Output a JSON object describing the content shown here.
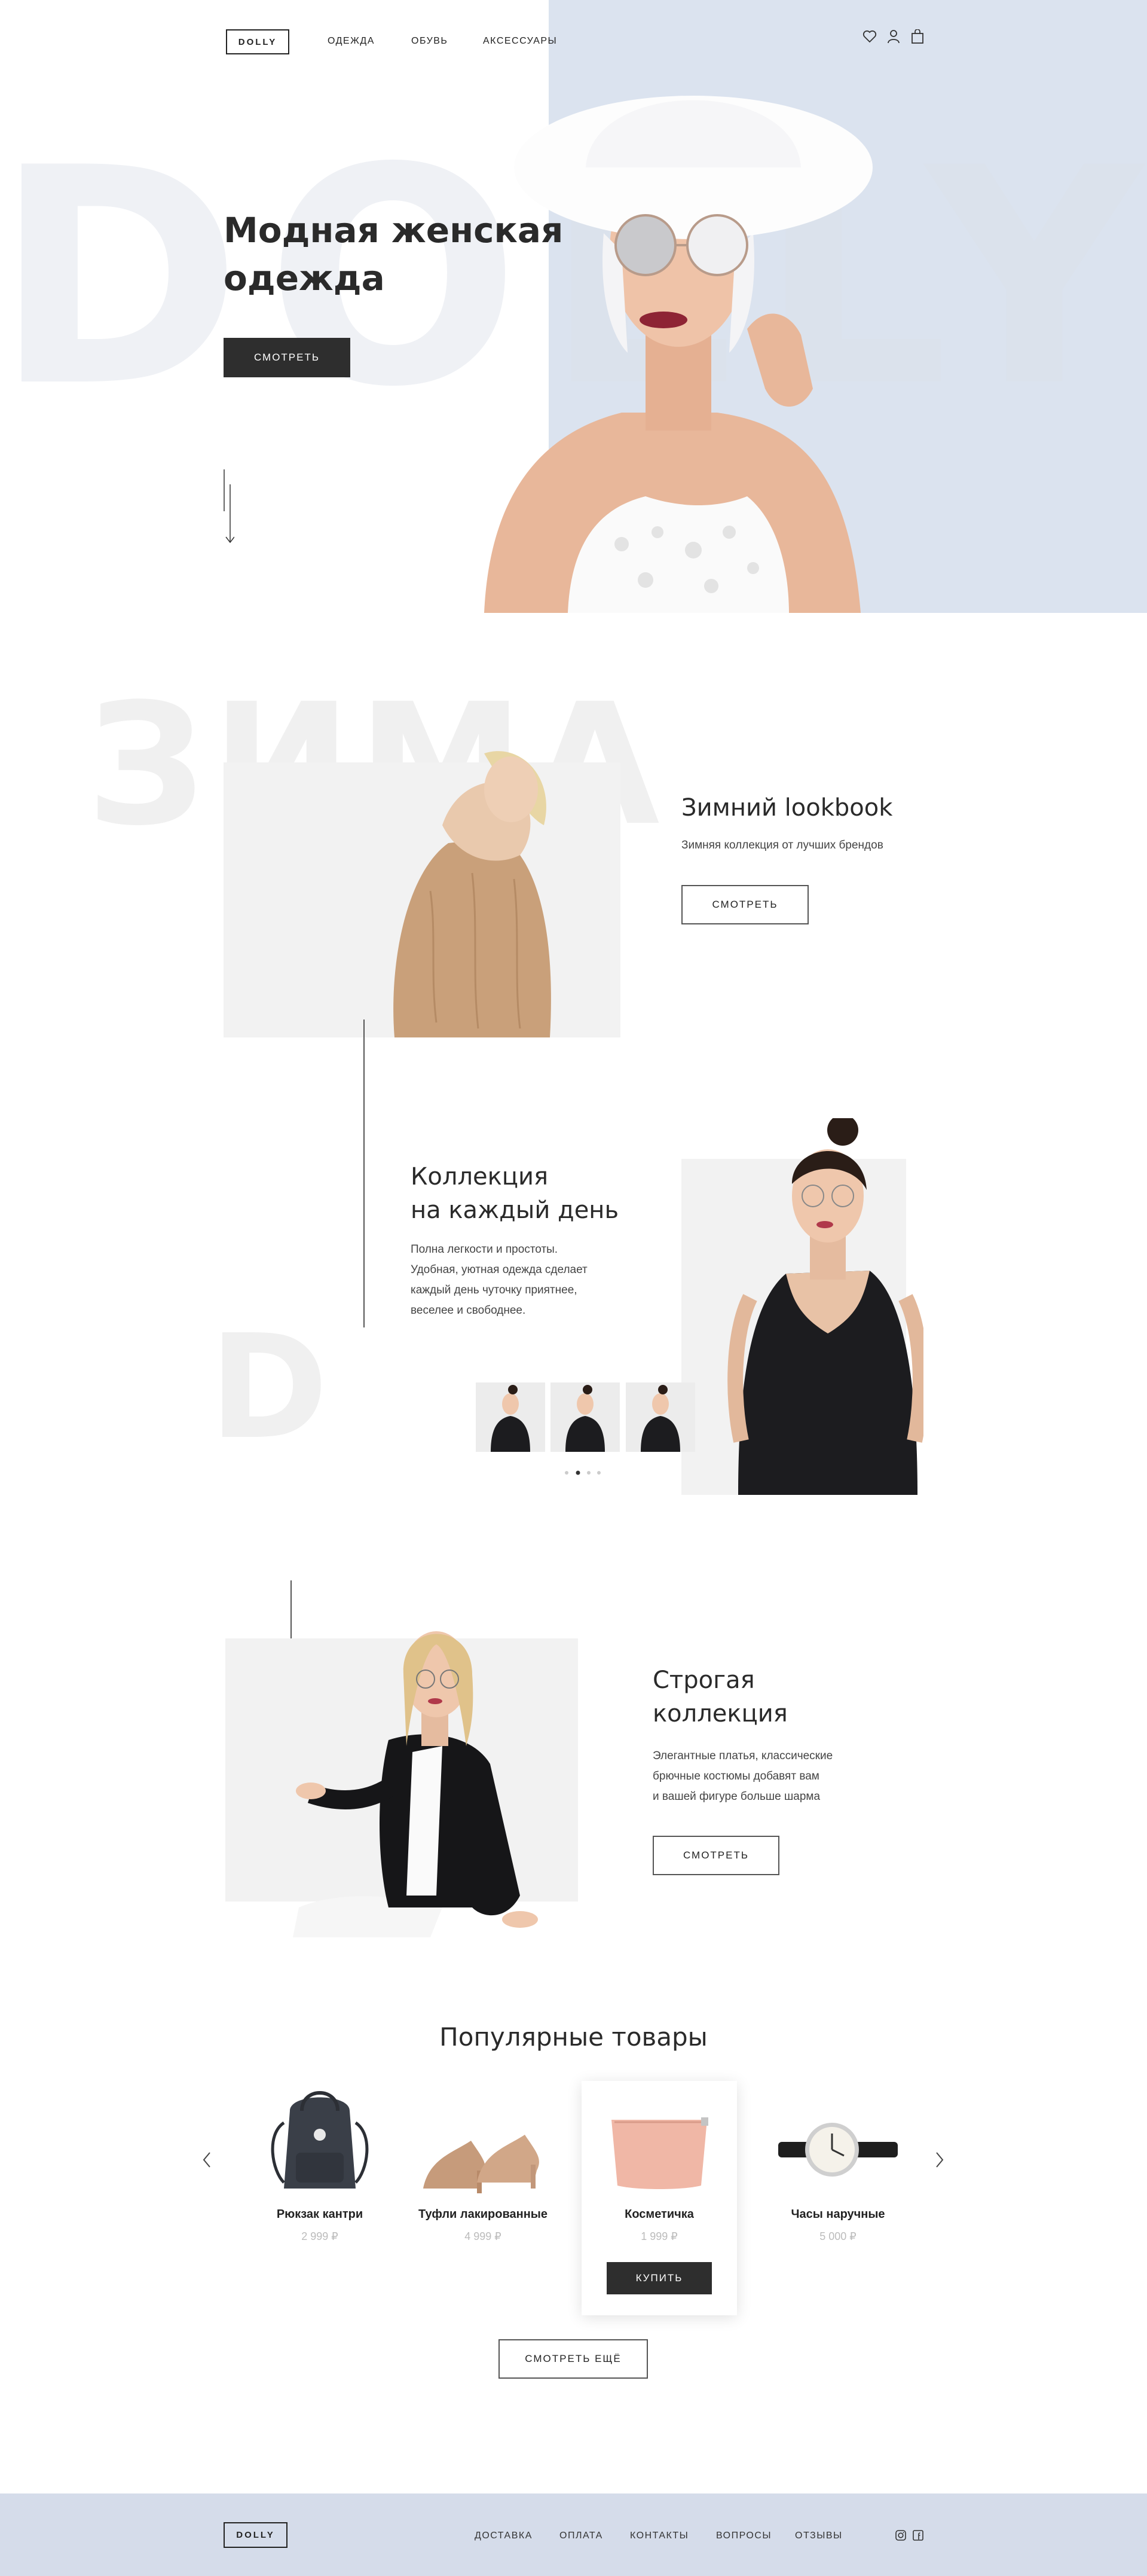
{
  "brand": "DOLLY",
  "nav": {
    "items": [
      "ОДЕЖДА",
      "ОБУВЬ",
      "АКСЕССУАРЫ"
    ]
  },
  "header_icons": [
    "heart-icon",
    "user-icon",
    "bag-icon"
  ],
  "hero": {
    "bg_word": "DOLLY",
    "title_line1": "Модная женская",
    "title_line2": "одежда",
    "button": "СМОТРЕТЬ"
  },
  "lookbook": {
    "bg_word": "ЗИМА",
    "title": "Зимний lookbook",
    "subtitle": "Зимняя коллекция от лучших брендов",
    "button": "СМОТРЕТЬ"
  },
  "everyday": {
    "bg_letter": "D",
    "title_line1": "Коллекция",
    "title_line2": "на каждый день",
    "text_lines": [
      "Полна легкости и простоты.",
      "Удобная, уютная одежда сделает",
      "каждый день чуточку приятнее,",
      "веселее и свободнее."
    ]
  },
  "strict": {
    "title_line1": "Строгая",
    "title_line2": "коллекция",
    "text_lines": [
      "Элегантные платья, классические",
      "брючные костюмы добавят вам",
      "и вашей фигуре больше шарма"
    ],
    "button": "СМОТРЕТЬ"
  },
  "popular": {
    "title": "Популярные товары",
    "products": [
      {
        "name": "Рюкзак кантри",
        "price": "2 999 ₽"
      },
      {
        "name": "Туфли лакированные",
        "price": "4 999 ₽"
      },
      {
        "name": "Косметичка",
        "price": "1 999 ₽",
        "button": "КУПИТЬ"
      },
      {
        "name": "Часы наручные",
        "price": "5 000 ₽"
      }
    ],
    "more_button": "СМОТРЕТЬ ЕЩЁ"
  },
  "footer": {
    "brand": "DOLLY",
    "links": [
      "ДОСТАВКА",
      "ОПЛАТА",
      "КОНТАКТЫ",
      "ВОПРОСЫ",
      "ОТЗЫВЫ"
    ],
    "social": [
      "instagram-icon",
      "facebook-icon"
    ]
  },
  "colors": {
    "hero_blue": "#dbe3ef",
    "footer_blue": "#d5dcea",
    "dark": "#2e2e2e",
    "light_gray": "#f2f2f2"
  }
}
